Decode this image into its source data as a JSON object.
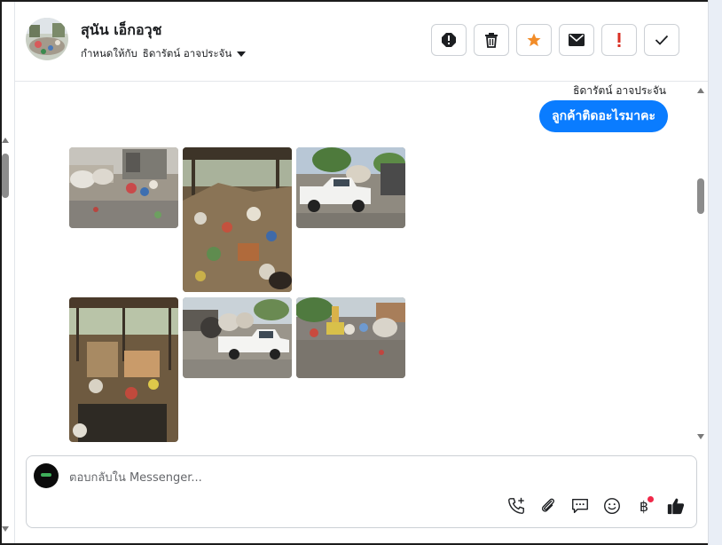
{
  "header": {
    "contact_name": "สุนัน เอ็กอวุช",
    "assign_prefix": "กำหนดให้กับ",
    "assignee": "ธิดารัตน์ อาจประจัน",
    "actions": [
      "spam-icon",
      "trash-icon",
      "star-icon",
      "mail-icon",
      "exclamation-icon",
      "check-icon"
    ]
  },
  "chat": {
    "sender_name": "ธิดารัตน์ อาจประจัน",
    "outgoing_message": "ลูกค้าติดอะไรมาคะ",
    "photos": [
      {
        "name": "junk-pile-shed"
      },
      {
        "name": "garbage-heap"
      },
      {
        "name": "white-pickup-truck"
      },
      {
        "name": "shelter-recyclables"
      },
      {
        "name": "loaded-pickup"
      },
      {
        "name": "recycle-yard"
      }
    ]
  },
  "composer": {
    "placeholder": "ตอบกลับใน Messenger...",
    "tools": [
      "add-call-icon",
      "attachment-icon",
      "saved-reply-icon",
      "emoji-icon",
      "payment-icon",
      "like-icon"
    ],
    "payment_symbol": "฿"
  },
  "colors": {
    "accent": "#0a7cff",
    "star": "#f28c28",
    "warning": "#d93025"
  }
}
